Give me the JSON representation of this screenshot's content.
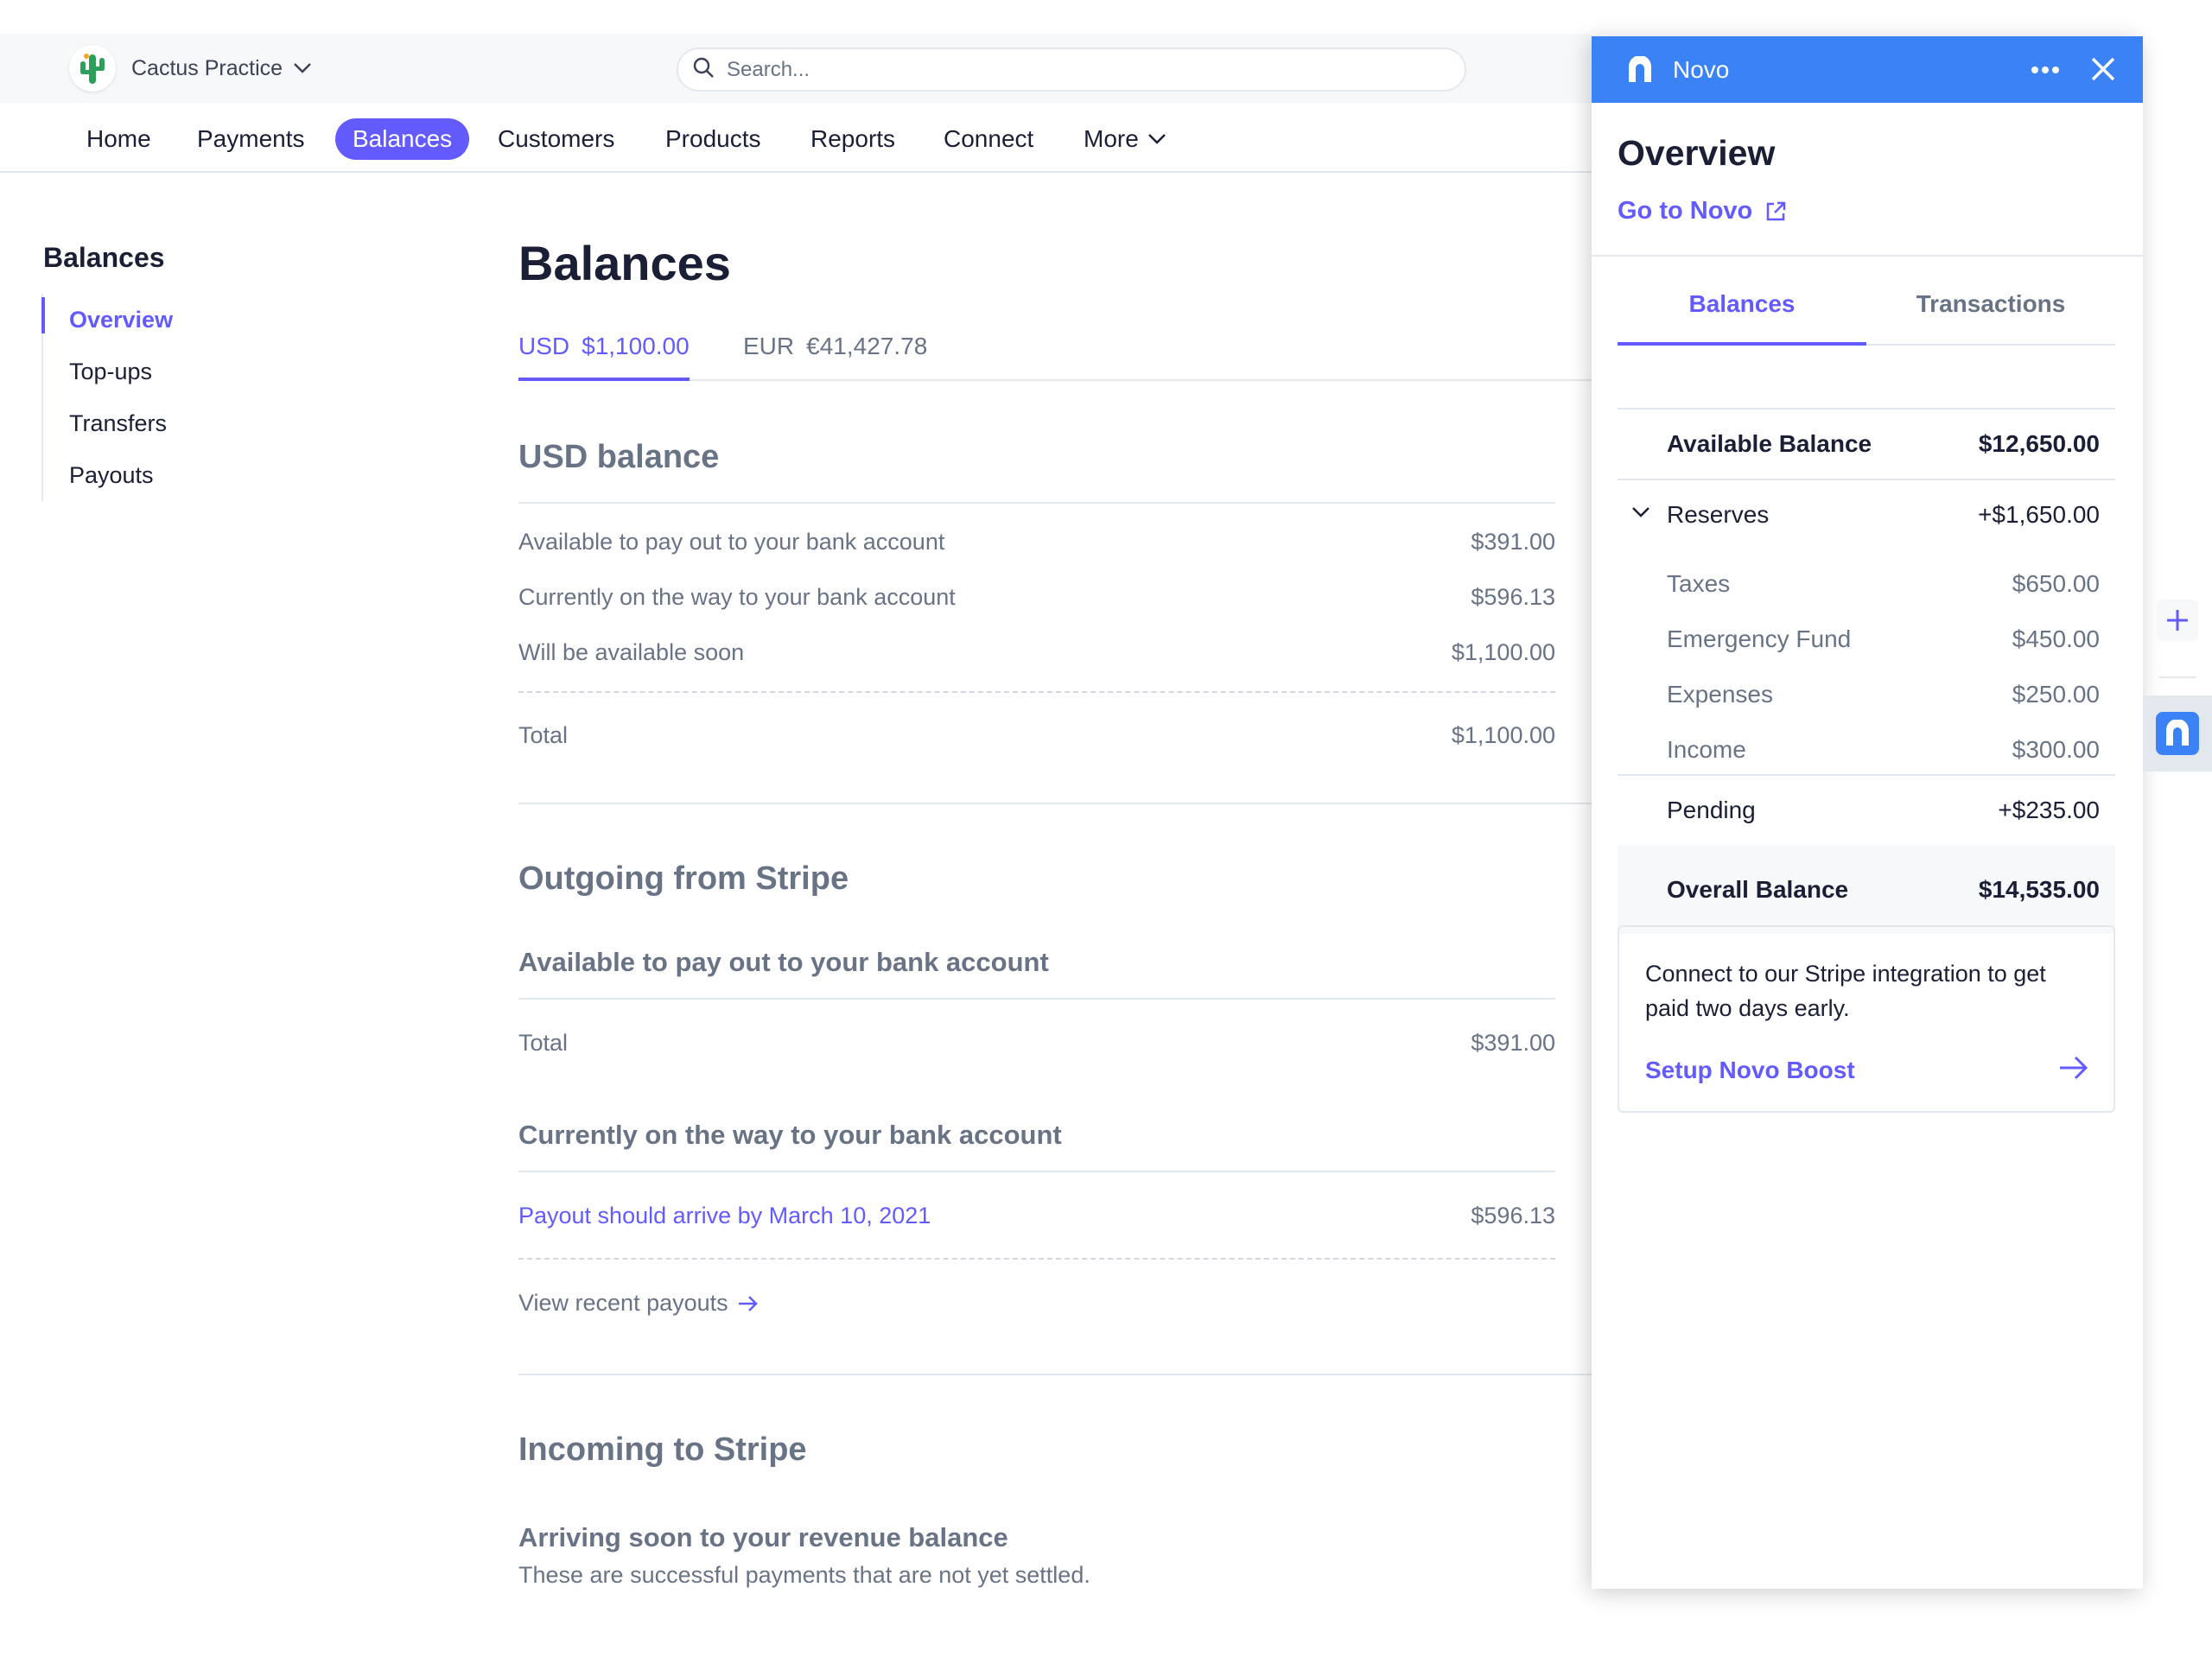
{
  "account": {
    "name": "Cactus Practice",
    "logo_icon": "cactus-icon"
  },
  "search": {
    "placeholder": "Search..."
  },
  "nav": {
    "items": [
      {
        "label": "Home"
      },
      {
        "label": "Payments"
      },
      {
        "label": "Balances",
        "active": true
      },
      {
        "label": "Customers"
      },
      {
        "label": "Products"
      },
      {
        "label": "Reports"
      },
      {
        "label": "Connect"
      },
      {
        "label": "More"
      }
    ]
  },
  "sidebar": {
    "title": "Balances",
    "items": [
      {
        "label": "Overview",
        "active": true
      },
      {
        "label": "Top-ups"
      },
      {
        "label": "Transfers"
      },
      {
        "label": "Payouts"
      }
    ]
  },
  "main": {
    "title": "Balances",
    "currency_tabs": [
      {
        "code": "USD",
        "amount": "$1,100.00",
        "active": true
      },
      {
        "code": "EUR",
        "amount": "€41,427.78"
      }
    ],
    "usd_balance": {
      "heading": "USD balance",
      "rows": [
        {
          "label": "Available to pay out to your bank account",
          "value": "$391.00"
        },
        {
          "label": "Currently on the way to your bank account",
          "value": "$596.13"
        },
        {
          "label": "Will be available soon",
          "value": "$1,100.00"
        }
      ],
      "total_label": "Total",
      "total_value": "$1,100.00"
    },
    "outgoing": {
      "heading": "Outgoing from Stripe",
      "available_heading": "Available to pay out to your bank account",
      "available_total_label": "Total",
      "available_total_value": "$391.00",
      "on_way_heading": "Currently on the way to your bank account",
      "payout_label": "Payout should arrive by March 10, 2021",
      "payout_value": "$596.13",
      "view_link": "View recent payouts"
    },
    "incoming": {
      "heading": "Incoming to Stripe",
      "sub_heading": "Arriving soon to your revenue balance",
      "description": "These are successful payments that are not yet settled."
    }
  },
  "drawer": {
    "app_name": "Novo",
    "title": "Overview",
    "go_link": "Go to Novo",
    "tabs": [
      {
        "label": "Balances",
        "active": true
      },
      {
        "label": "Transactions"
      }
    ],
    "available_label": "Available Balance",
    "available_value": "$12,650.00",
    "reserves_label": "Reserves",
    "reserves_value": "+$1,650.00",
    "reserves": [
      {
        "label": "Taxes",
        "value": "$650.00"
      },
      {
        "label": "Emergency Fund",
        "value": "$450.00"
      },
      {
        "label": "Expenses",
        "value": "$250.00"
      },
      {
        "label": "Income",
        "value": "$300.00"
      }
    ],
    "pending_label": "Pending",
    "pending_value": "+$235.00",
    "overall_label": "Overall Balance",
    "overall_value": "$14,535.00",
    "boost": {
      "text": "Connect to our Stripe integration to get paid two days early.",
      "link": "Setup Novo Boost"
    }
  },
  "colors": {
    "accent": "#635bff",
    "novo_blue": "#3b82f6",
    "muted_text": "#697386",
    "border": "#e3e8ee"
  }
}
